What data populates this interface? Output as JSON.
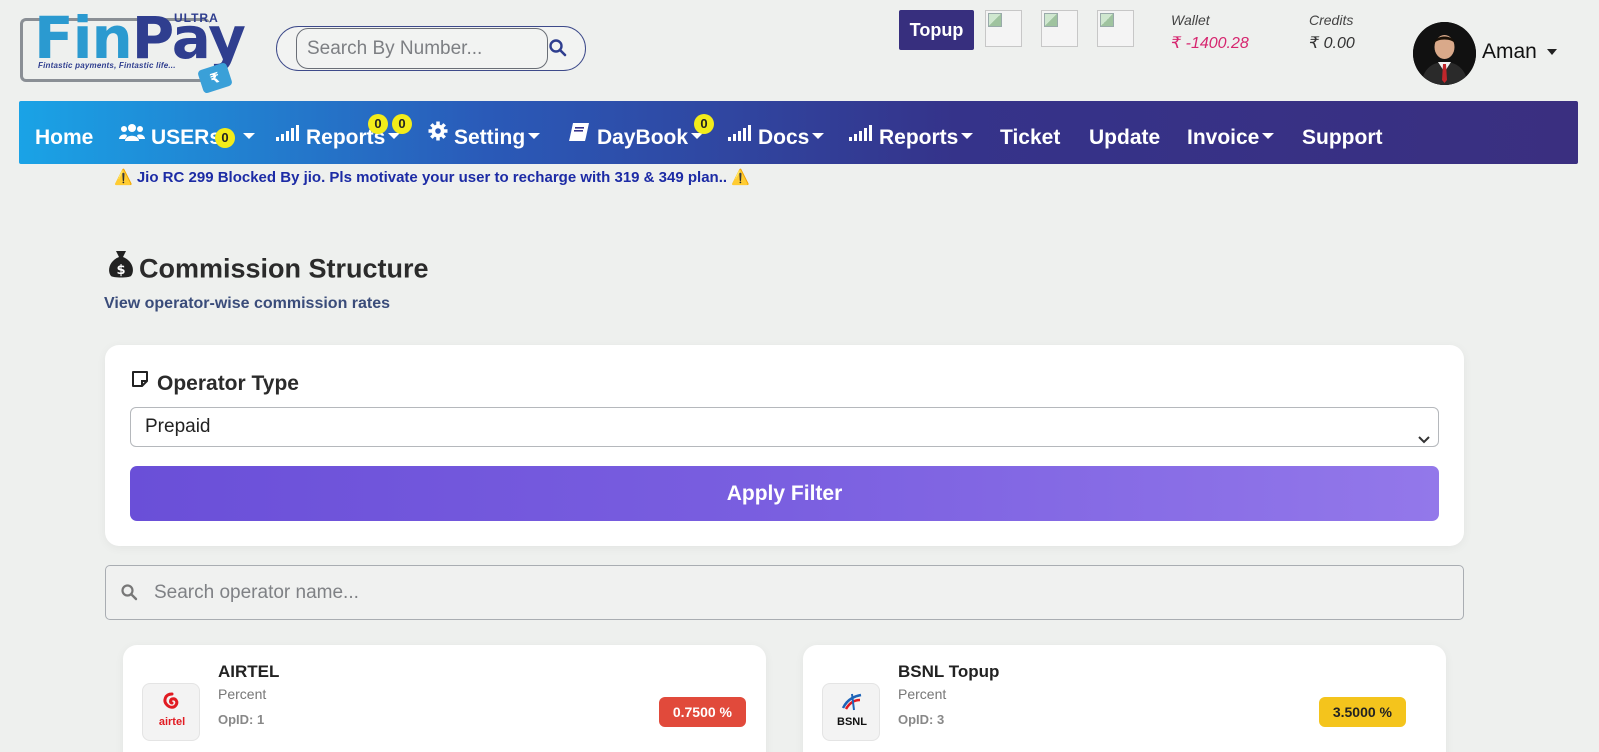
{
  "brand": {
    "word_fin": "Fin",
    "word_pay": "Pay",
    "ultra": "ULTRA",
    "tagline": "Fintastic payments, Fintastic life..."
  },
  "header": {
    "search_placeholder": "Search By Number...",
    "topup_label": "Topup",
    "wallet_label": "Wallet",
    "wallet_value": "₹ -1400.28",
    "credits_label": "Credits",
    "credits_value": "₹ 0.00",
    "user_name": "Aman"
  },
  "nav": {
    "items": [
      {
        "label": "Home"
      },
      {
        "label": "USERs",
        "badge": "0"
      },
      {
        "label": "Reports",
        "badges": [
          "0",
          "0"
        ]
      },
      {
        "label": "Setting"
      },
      {
        "label": "DayBook",
        "badge": "0"
      },
      {
        "label": "Docs"
      },
      {
        "label": "Reports"
      },
      {
        "label": "Ticket"
      },
      {
        "label": "Update"
      },
      {
        "label": "Invoice"
      },
      {
        "label": "Support"
      }
    ]
  },
  "notice": "⚠️ Jio RC 299 Blocked By jio. Pls motivate your user to recharge with 319 & 349 plan.. ⚠️",
  "page": {
    "title": "Commission Structure",
    "subtitle": "View operator-wise commission rates"
  },
  "filter": {
    "label": "Operator Type",
    "selected": "Prepaid",
    "apply_label": "Apply Filter"
  },
  "operator_search": {
    "placeholder": "Search operator name..."
  },
  "operators": [
    {
      "name": "AIRTEL",
      "type": "Percent",
      "opid_label": "OpID:",
      "opid": "1",
      "rate": "0.7500 %",
      "logo_text": "airtel",
      "badge_color": "#e14a3b",
      "badge_text_color": "#ffffff"
    },
    {
      "name": "BSNL Topup",
      "type": "Percent",
      "opid_label": "OpID:",
      "opid": "3",
      "rate": "3.5000 %",
      "logo_text": "BSNL",
      "badge_color": "#f4c41c",
      "badge_text_color": "#222222"
    }
  ]
}
